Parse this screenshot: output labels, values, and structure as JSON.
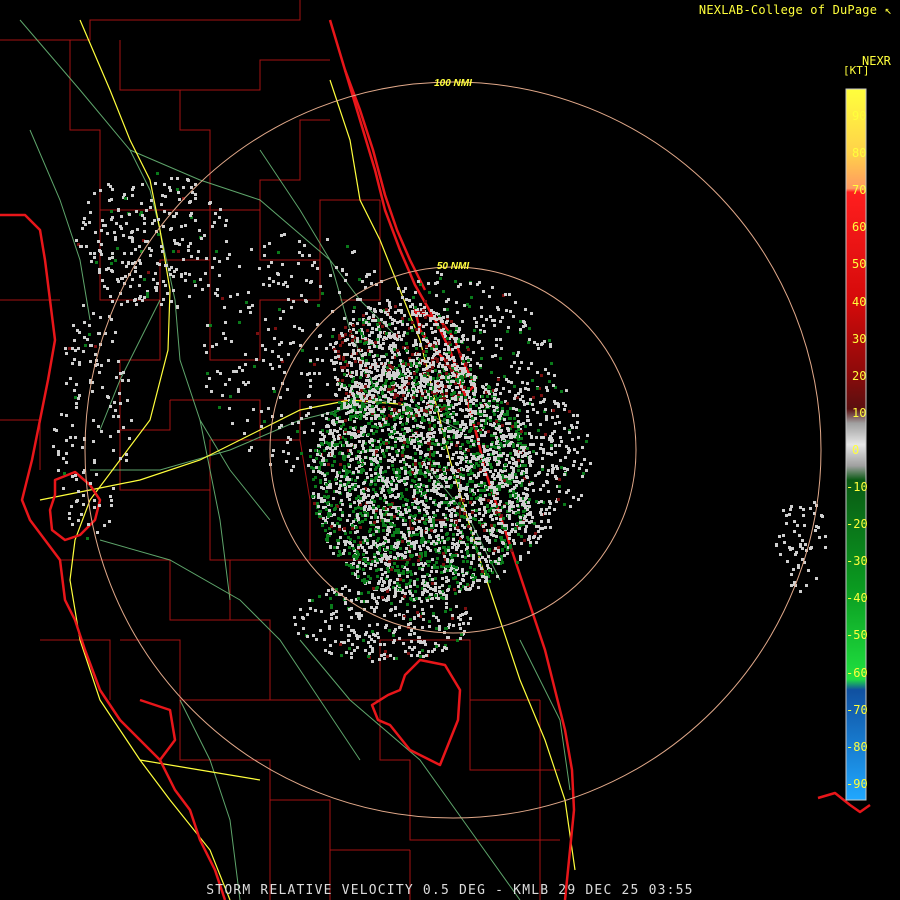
{
  "credit": "NEXLAB-College of DuPage",
  "footer": "STORM RELATIVE VELOCITY 0.5 DEG - KMLB 29 DEC 25 03:55",
  "legend": {
    "product": "NEXR",
    "unit": "[KT]",
    "ticks": [
      "90",
      "80",
      "70",
      "60",
      "50",
      "40",
      "30",
      "20",
      "10",
      "0",
      "-10",
      "-20",
      "-30",
      "-40",
      "-50",
      "-60",
      "-70",
      "-80",
      "-90"
    ]
  },
  "range_rings": [
    {
      "label": "50 NMI"
    },
    {
      "label": "100 NMI"
    }
  ],
  "colors": {
    "background": "#000000",
    "coastline": "#e8161a",
    "county_lines": "#b01010",
    "highways": "#ffff3c",
    "roads": "#7fd48a",
    "range_rings": "#e2a98a",
    "inbound": "#0a7a1a",
    "outbound": "#7a0f10",
    "near_zero": "#cfcfcf"
  }
}
